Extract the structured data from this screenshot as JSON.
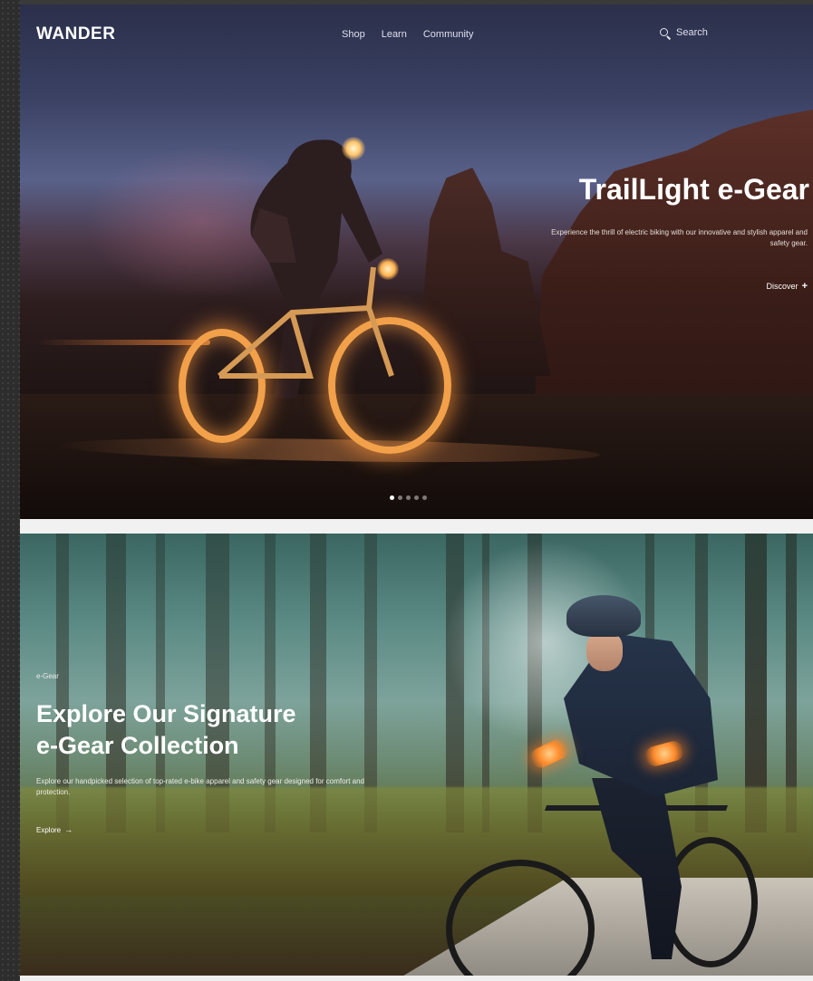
{
  "nav": {
    "logo": "WANDER",
    "links": [
      "Shop",
      "Learn",
      "Community"
    ],
    "search_label": "Search"
  },
  "hero": {
    "title": "TrailLight e-Gear",
    "description": "Experience the thrill of electric biking with our innovative and stylish apparel and safety gear.",
    "cta": "Discover",
    "cta_icon": "plus-icon",
    "slides": 5,
    "active_slide": 1
  },
  "section2": {
    "eyebrow": "e-Gear",
    "title_line1": "Explore Our Signature",
    "title_line2": "e-Gear Collection",
    "description": "Explore our handpicked selection of top-rated e-bike apparel and safety gear designed for comfort and protection.",
    "cta": "Explore",
    "cta_icon": "arrow-right-icon"
  },
  "colors": {
    "accent_glow": "#ffb24f",
    "text": "#ffffff"
  }
}
